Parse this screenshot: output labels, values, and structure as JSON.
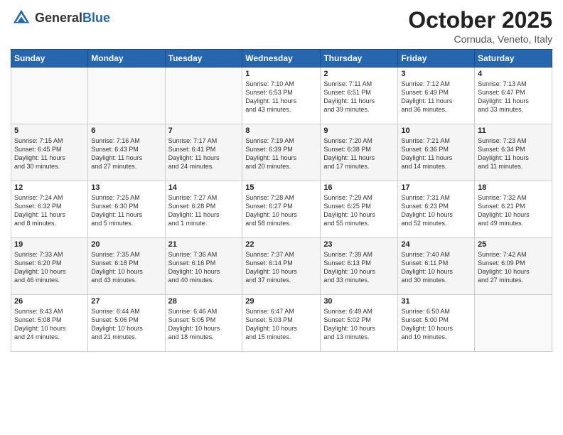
{
  "header": {
    "logo_general": "General",
    "logo_blue": "Blue",
    "month_title": "October 2025",
    "subtitle": "Cornuda, Veneto, Italy"
  },
  "days_of_week": [
    "Sunday",
    "Monday",
    "Tuesday",
    "Wednesday",
    "Thursday",
    "Friday",
    "Saturday"
  ],
  "weeks": [
    [
      {
        "day": "",
        "info": ""
      },
      {
        "day": "",
        "info": ""
      },
      {
        "day": "",
        "info": ""
      },
      {
        "day": "1",
        "info": "Sunrise: 7:10 AM\nSunset: 6:53 PM\nDaylight: 11 hours\nand 43 minutes."
      },
      {
        "day": "2",
        "info": "Sunrise: 7:11 AM\nSunset: 6:51 PM\nDaylight: 11 hours\nand 39 minutes."
      },
      {
        "day": "3",
        "info": "Sunrise: 7:12 AM\nSunset: 6:49 PM\nDaylight: 11 hours\nand 36 minutes."
      },
      {
        "day": "4",
        "info": "Sunrise: 7:13 AM\nSunset: 6:47 PM\nDaylight: 11 hours\nand 33 minutes."
      }
    ],
    [
      {
        "day": "5",
        "info": "Sunrise: 7:15 AM\nSunset: 6:45 PM\nDaylight: 11 hours\nand 30 minutes."
      },
      {
        "day": "6",
        "info": "Sunrise: 7:16 AM\nSunset: 6:43 PM\nDaylight: 11 hours\nand 27 minutes."
      },
      {
        "day": "7",
        "info": "Sunrise: 7:17 AM\nSunset: 6:41 PM\nDaylight: 11 hours\nand 24 minutes."
      },
      {
        "day": "8",
        "info": "Sunrise: 7:19 AM\nSunset: 6:39 PM\nDaylight: 11 hours\nand 20 minutes."
      },
      {
        "day": "9",
        "info": "Sunrise: 7:20 AM\nSunset: 6:38 PM\nDaylight: 11 hours\nand 17 minutes."
      },
      {
        "day": "10",
        "info": "Sunrise: 7:21 AM\nSunset: 6:36 PM\nDaylight: 11 hours\nand 14 minutes."
      },
      {
        "day": "11",
        "info": "Sunrise: 7:23 AM\nSunset: 6:34 PM\nDaylight: 11 hours\nand 11 minutes."
      }
    ],
    [
      {
        "day": "12",
        "info": "Sunrise: 7:24 AM\nSunset: 6:32 PM\nDaylight: 11 hours\nand 8 minutes."
      },
      {
        "day": "13",
        "info": "Sunrise: 7:25 AM\nSunset: 6:30 PM\nDaylight: 11 hours\nand 5 minutes."
      },
      {
        "day": "14",
        "info": "Sunrise: 7:27 AM\nSunset: 6:28 PM\nDaylight: 11 hours\nand 1 minute."
      },
      {
        "day": "15",
        "info": "Sunrise: 7:28 AM\nSunset: 6:27 PM\nDaylight: 10 hours\nand 58 minutes."
      },
      {
        "day": "16",
        "info": "Sunrise: 7:29 AM\nSunset: 6:25 PM\nDaylight: 10 hours\nand 55 minutes."
      },
      {
        "day": "17",
        "info": "Sunrise: 7:31 AM\nSunset: 6:23 PM\nDaylight: 10 hours\nand 52 minutes."
      },
      {
        "day": "18",
        "info": "Sunrise: 7:32 AM\nSunset: 6:21 PM\nDaylight: 10 hours\nand 49 minutes."
      }
    ],
    [
      {
        "day": "19",
        "info": "Sunrise: 7:33 AM\nSunset: 6:20 PM\nDaylight: 10 hours\nand 46 minutes."
      },
      {
        "day": "20",
        "info": "Sunrise: 7:35 AM\nSunset: 6:18 PM\nDaylight: 10 hours\nand 43 minutes."
      },
      {
        "day": "21",
        "info": "Sunrise: 7:36 AM\nSunset: 6:16 PM\nDaylight: 10 hours\nand 40 minutes."
      },
      {
        "day": "22",
        "info": "Sunrise: 7:37 AM\nSunset: 6:14 PM\nDaylight: 10 hours\nand 37 minutes."
      },
      {
        "day": "23",
        "info": "Sunrise: 7:39 AM\nSunset: 6:13 PM\nDaylight: 10 hours\nand 33 minutes."
      },
      {
        "day": "24",
        "info": "Sunrise: 7:40 AM\nSunset: 6:11 PM\nDaylight: 10 hours\nand 30 minutes."
      },
      {
        "day": "25",
        "info": "Sunrise: 7:42 AM\nSunset: 6:09 PM\nDaylight: 10 hours\nand 27 minutes."
      }
    ],
    [
      {
        "day": "26",
        "info": "Sunrise: 6:43 AM\nSunset: 5:08 PM\nDaylight: 10 hours\nand 24 minutes."
      },
      {
        "day": "27",
        "info": "Sunrise: 6:44 AM\nSunset: 5:06 PM\nDaylight: 10 hours\nand 21 minutes."
      },
      {
        "day": "28",
        "info": "Sunrise: 6:46 AM\nSunset: 5:05 PM\nDaylight: 10 hours\nand 18 minutes."
      },
      {
        "day": "29",
        "info": "Sunrise: 6:47 AM\nSunset: 5:03 PM\nDaylight: 10 hours\nand 15 minutes."
      },
      {
        "day": "30",
        "info": "Sunrise: 6:49 AM\nSunset: 5:02 PM\nDaylight: 10 hours\nand 13 minutes."
      },
      {
        "day": "31",
        "info": "Sunrise: 6:50 AM\nSunset: 5:00 PM\nDaylight: 10 hours\nand 10 minutes."
      },
      {
        "day": "",
        "info": ""
      }
    ]
  ]
}
